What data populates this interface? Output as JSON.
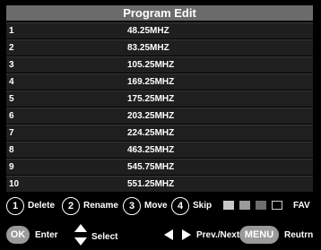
{
  "window": {
    "title": "Program Edit"
  },
  "programs": [
    {
      "num": "1",
      "freq": "48.25MHZ"
    },
    {
      "num": "2",
      "freq": "83.25MHZ"
    },
    {
      "num": "3",
      "freq": "105.25MHZ"
    },
    {
      "num": "4",
      "freq": "169.25MHZ"
    },
    {
      "num": "5",
      "freq": "175.25MHZ"
    },
    {
      "num": "6",
      "freq": "203.25MHZ"
    },
    {
      "num": "7",
      "freq": "224.25MHZ"
    },
    {
      "num": "8",
      "freq": "463.25MHZ"
    },
    {
      "num": "9",
      "freq": "545.75MHZ"
    },
    {
      "num": "10",
      "freq": "551.25MHZ"
    }
  ],
  "legend": {
    "k1": "1",
    "delete": "Delete",
    "k2": "2",
    "rename": "Rename",
    "k3": "3",
    "move": "Move",
    "k4": "4",
    "skip": "Skip",
    "fav": "FAV",
    "ok": "OK",
    "enter": "Enter",
    "select": "Select",
    "prevnext": "Prev./Next",
    "menu": "MENU",
    "return": "Reutrn"
  },
  "colors": {
    "title_bg": "#6b6b6b",
    "row_bg": "#1f1f1f",
    "pill": "#9a9a9a"
  }
}
